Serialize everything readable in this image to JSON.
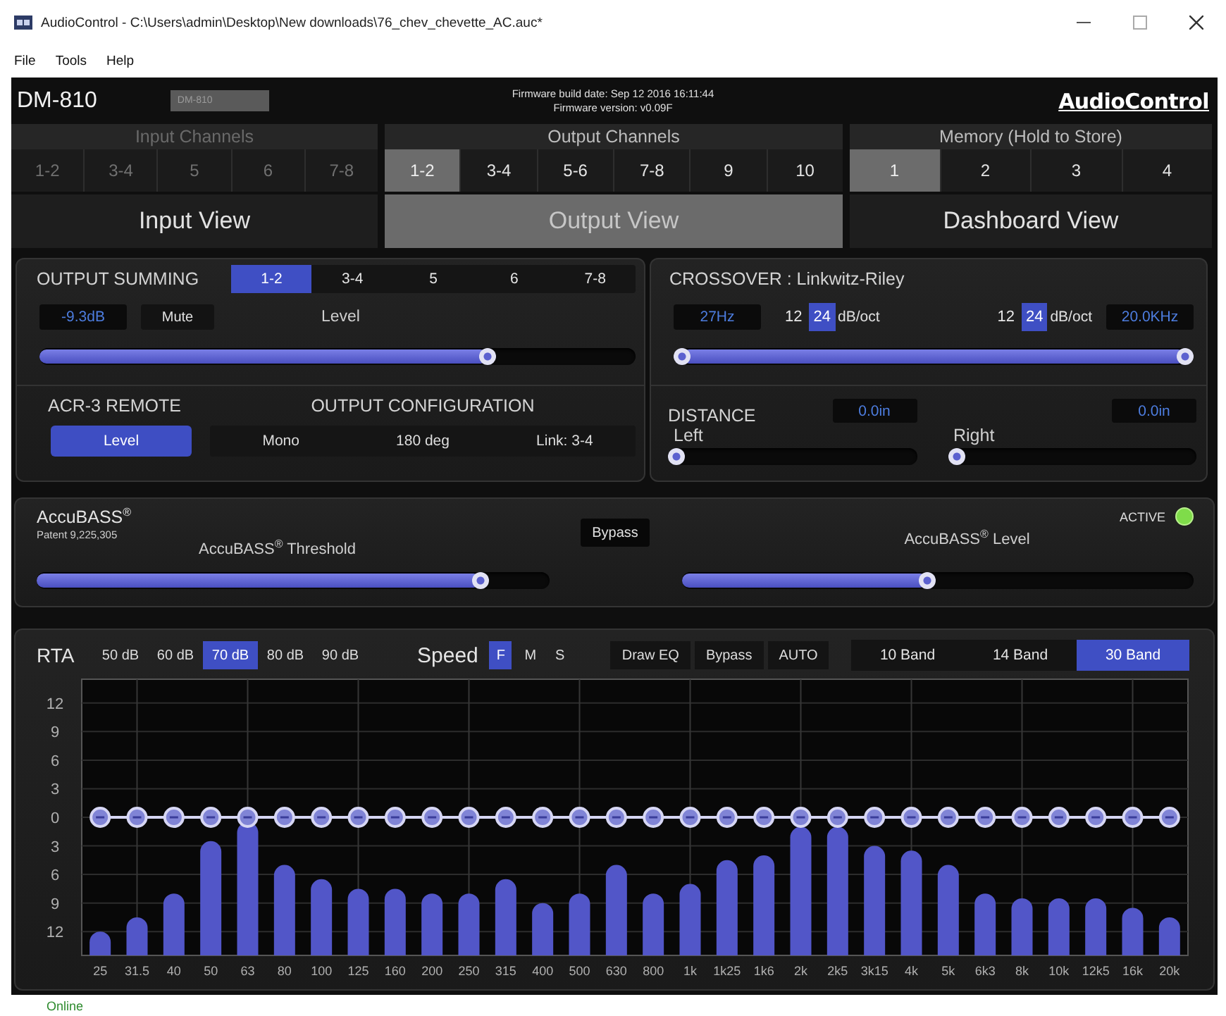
{
  "window": {
    "title": "AudioControl - C:\\Users\\admin\\Desktop\\New downloads\\76_chev_chevette_AC.auc*"
  },
  "menu": [
    "File",
    "Tools",
    "Help"
  ],
  "header": {
    "device": "DM-810",
    "device_select": {
      "value": "DM-810",
      "disabled": true
    },
    "firmware_build": "Firmware build date: Sep 12 2016 16:11:44",
    "firmware_version": "Firmware version: v0.09F",
    "logo": "AudioControl"
  },
  "channel_groups": [
    {
      "title": "Input Channels",
      "disabled": true,
      "buttons": [
        {
          "label": "1-2",
          "selected": false
        },
        {
          "label": "3-4",
          "selected": false
        },
        {
          "label": "5",
          "selected": false
        },
        {
          "label": "6",
          "selected": false
        },
        {
          "label": "7-8",
          "selected": false
        }
      ]
    },
    {
      "title": "Output Channels",
      "disabled": false,
      "buttons": [
        {
          "label": "1-2",
          "selected": true
        },
        {
          "label": "3-4",
          "selected": false
        },
        {
          "label": "5-6",
          "selected": false
        },
        {
          "label": "7-8",
          "selected": false
        },
        {
          "label": "9",
          "selected": false
        },
        {
          "label": "10",
          "selected": false
        }
      ]
    },
    {
      "title": "Memory (Hold to Store)",
      "disabled": false,
      "buttons": [
        {
          "label": "1",
          "selected": true
        },
        {
          "label": "2",
          "selected": false
        },
        {
          "label": "3",
          "selected": false
        },
        {
          "label": "4",
          "selected": false
        }
      ]
    }
  ],
  "views": [
    {
      "label": "Input View",
      "selected": false
    },
    {
      "label": "Output View",
      "selected": true
    },
    {
      "label": "Dashboard View",
      "selected": false
    }
  ],
  "output_summing": {
    "title": "OUTPUT SUMMING",
    "tabs": [
      {
        "label": "1-2",
        "selected": true
      },
      {
        "label": "3-4",
        "selected": false
      },
      {
        "label": "5",
        "selected": false
      },
      {
        "label": "6",
        "selected": false
      },
      {
        "label": "7-8",
        "selected": false
      }
    ],
    "level_reading": "-9.3dB",
    "mute": {
      "label": "Mute",
      "on": false
    },
    "slider_label": "Level",
    "level": 0.76
  },
  "crossover": {
    "title": "CROSSOVER : Linkwitz-Riley",
    "low_frequency": "27Hz",
    "slopes": [
      {
        "options": [
          {
            "label": "12",
            "selected": false
          },
          {
            "label": "24",
            "selected": true
          }
        ],
        "unit": "dB/oct"
      },
      {
        "options": [
          {
            "label": "12",
            "selected": false
          },
          {
            "label": "24",
            "selected": true
          }
        ],
        "unit": "dB/oct"
      }
    ],
    "high_frequency": "20.0KHz",
    "thumbs": [
      {
        "level": 0
      },
      {
        "level": 1
      }
    ]
  },
  "acr3_remote": {
    "title": "ACR-3 REMOTE",
    "button": {
      "label": "Level",
      "on": true
    }
  },
  "output_configuration": {
    "title": "OUTPUT CONFIGURATION",
    "toggles": [
      {
        "label": "Mono",
        "on": false
      },
      {
        "label": "180 deg",
        "on": false
      },
      {
        "label": "Link: 3-4",
        "on": false
      }
    ]
  },
  "distance": {
    "title": "DISTANCE",
    "channels": [
      {
        "label": "Left",
        "reading": "0.0in",
        "level": 0
      },
      {
        "label": "Right",
        "reading": "0.0in",
        "level": 0
      }
    ]
  },
  "accubass": {
    "title": "AccuBASS$^{®}$",
    "patent": "Patent 9,225,305",
    "bypass": {
      "label": "Bypass",
      "on": false
    },
    "status": {
      "label": "ACTIVE",
      "on": true
    },
    "sliders": [
      {
        "label": "AccuBASS$^{®}$ Threshold",
        "level": 0.88
      },
      {
        "label": "AccuBASS$^{®}$ Level",
        "level": 0.48
      }
    ]
  },
  "rta": {
    "title": "RTA",
    "ranges": [
      {
        "label": "50 dB",
        "selected": false
      },
      {
        "label": "60 dB",
        "selected": false
      },
      {
        "label": "70 dB",
        "selected": true
      },
      {
        "label": "80 dB",
        "selected": false
      },
      {
        "label": "90 dB",
        "selected": false
      }
    ],
    "speed": {
      "label": "Speed",
      "options": [
        {
          "label": "F",
          "selected": true
        },
        {
          "label": "M",
          "selected": false
        },
        {
          "label": "S",
          "selected": false
        }
      ]
    },
    "actions": [
      {
        "label": "Draw EQ",
        "on": false
      },
      {
        "label": "Bypass",
        "on": false
      },
      {
        "label": "AUTO",
        "on": false
      }
    ],
    "bands": [
      {
        "label": "10 Band",
        "selected": false
      },
      {
        "label": "14 Band",
        "selected": false
      },
      {
        "label": "30 Band",
        "selected": true
      }
    ],
    "chart_data": {
      "type": "line",
      "grid": true,
      "categories": [
        "25",
        "31.5",
        "40",
        "50",
        "63",
        "80",
        "100",
        "125",
        "160",
        "200",
        "250",
        "315",
        "400",
        "500",
        "630",
        "800",
        "1k",
        "1k25",
        "1k6",
        "2k",
        "2k5",
        "3k15",
        "4k",
        "5k",
        "6k3",
        "8k",
        "10k",
        "12k5",
        "16k",
        "20k"
      ],
      "series": [
        {
          "color": "#d6d6f4",
          "marker": "circle",
          "values": [
            0,
            0,
            0,
            0,
            0,
            0,
            0,
            0,
            0,
            0,
            0,
            0,
            0,
            0,
            0,
            0,
            0,
            0,
            0,
            0,
            0,
            0,
            0,
            0,
            0,
            0,
            0,
            0,
            0,
            0
          ]
        }
      ],
      "ylim": [
        -14.5,
        14.5
      ],
      "yticks": [
        12,
        9,
        6,
        3,
        0,
        {
          "value": -3,
          "label": "3"
        },
        {
          "value": -6,
          "label": "6"
        },
        {
          "value": -9,
          "label": "9"
        },
        {
          "value": -12,
          "label": "12"
        }
      ]
    }
  },
  "status_bar": {
    "text": "Online"
  }
}
